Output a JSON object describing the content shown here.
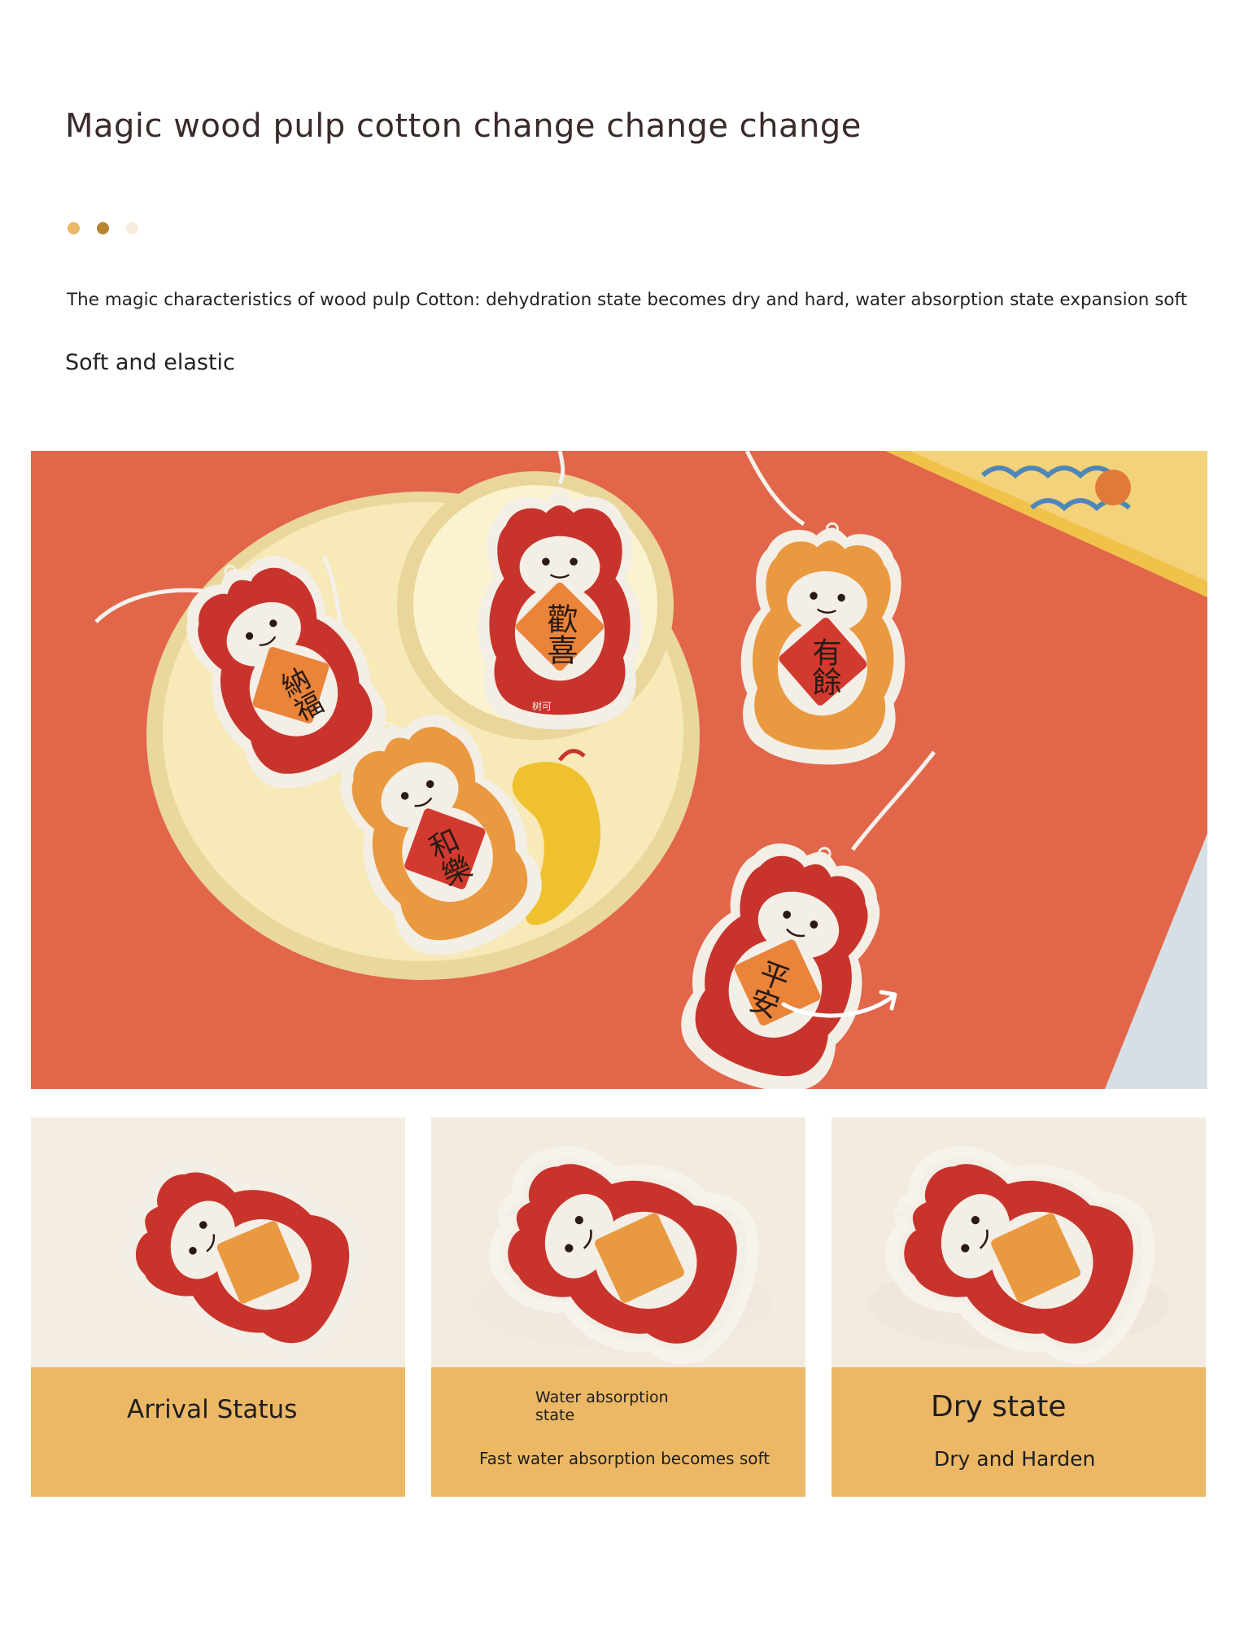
{
  "header": {
    "title": "Magic wood pulp cotton change change change",
    "dot_colors": [
      "#e9b766",
      "#b8852f",
      "#f7ecdc"
    ]
  },
  "intro": {
    "description": "The magic characteristics of wood pulp Cotton: dehydration state becomes dry and hard, water absorption state expansion soft",
    "subtitle": "Soft and elastic"
  },
  "hero": {
    "sponges": [
      {
        "text": "歡喜",
        "body_color": "#c8342c",
        "tag_color": "#e9843a"
      },
      {
        "text": "有餘",
        "body_color": "#e9993f",
        "tag_color": "#d33a2f"
      },
      {
        "text": "納福",
        "body_color": "#c8342c",
        "tag_color": "#e9843a"
      },
      {
        "text": "和樂",
        "body_color": "#e9993f",
        "tag_color": "#d33a2f"
      },
      {
        "text": "平安",
        "body_color": "#c8342c",
        "tag_color": "#e9843a"
      }
    ],
    "brand_mark": "树可"
  },
  "panels": [
    {
      "label": "Arrival Status",
      "subtext": ""
    },
    {
      "label": "Water absorption\nstate",
      "subtext": "Fast water absorption becomes soft"
    },
    {
      "label": "Dry state",
      "subtext": "Dry and Harden"
    }
  ],
  "colors": {
    "accent": "#ecb866",
    "background_red": "#e2664a",
    "plate": "#f6e7b4",
    "dragon_red": "#c8342c",
    "dragon_orange": "#e9993f"
  }
}
